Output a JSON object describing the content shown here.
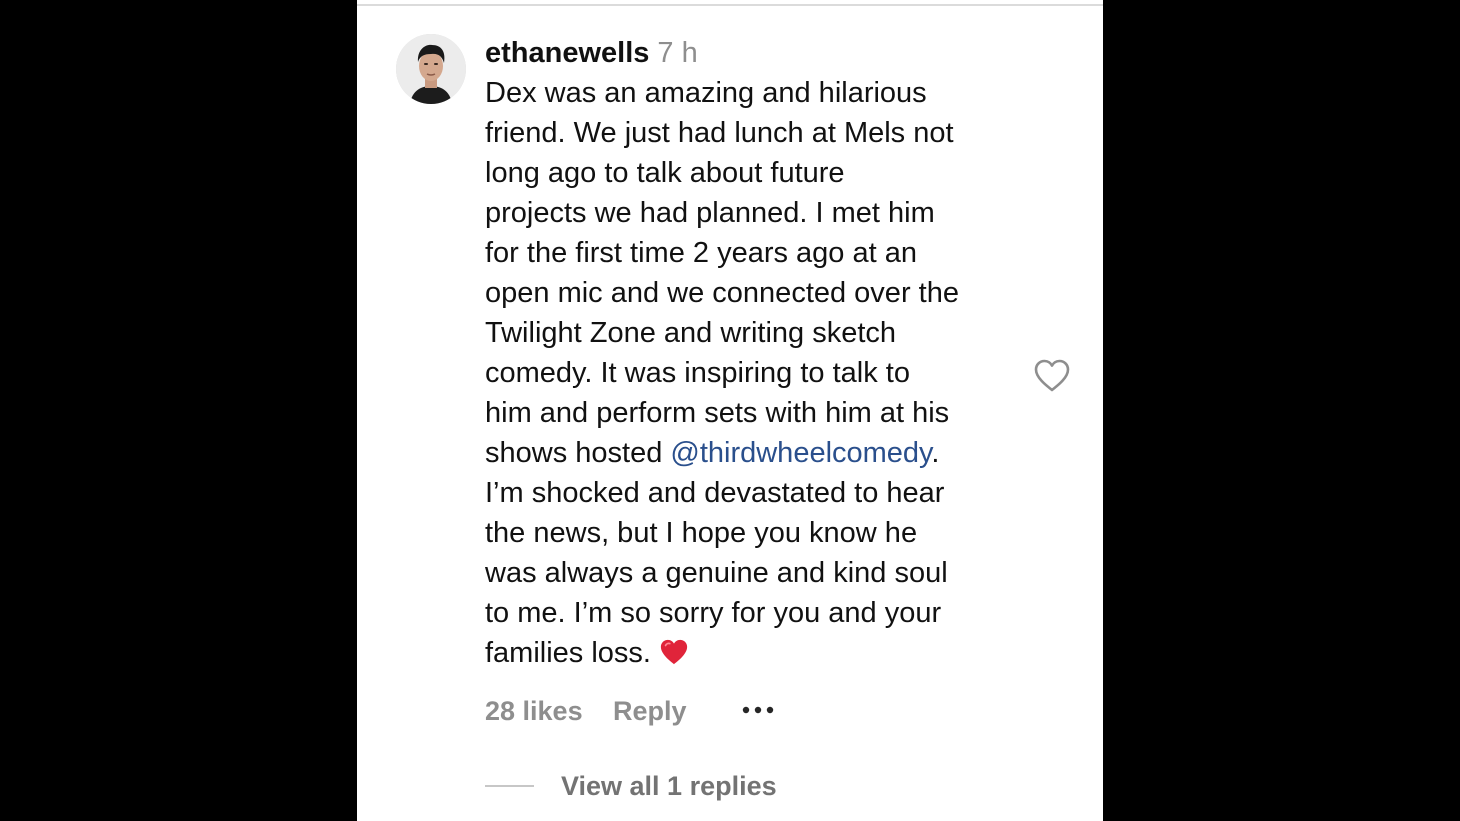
{
  "comment": {
    "username": "ethanewells",
    "timestamp": "7 h",
    "lines": [
      "Dex was an amazing and hilarious",
      "friend. We just had lunch at Mels not",
      "long ago to talk about future",
      "projects we had planned. I met him",
      "for the first time 2 years ago at an",
      "open mic and we connected over the",
      "Twilight Zone and writing sketch",
      "comedy. It was inspiring to talk to",
      "him and perform sets with him at his"
    ],
    "mention_line_prefix": "shows hosted ",
    "mention": "@thirdwheelcomedy",
    "mention_line_suffix": ".",
    "lines_after": [
      "I’m shocked and devastated to hear",
      "the news, but I hope you know he",
      "was always a genuine and kind soul",
      "to me. I’m so sorry for you and your"
    ],
    "last_line": "families loss.",
    "emoji": "red-heart-emoji"
  },
  "actions": {
    "likes": "28 likes",
    "reply": "Reply",
    "more_icon": "more-options-icon",
    "like_icon": "heart-outline-icon"
  },
  "replies": {
    "view_label": "View all 1 replies"
  },
  "colors": {
    "background": "#000000",
    "panel": "#ffffff",
    "text": "#111111",
    "secondary": "#8e8e8e",
    "mention": "#2a4f8c",
    "emoji_red": "#e0243a"
  }
}
